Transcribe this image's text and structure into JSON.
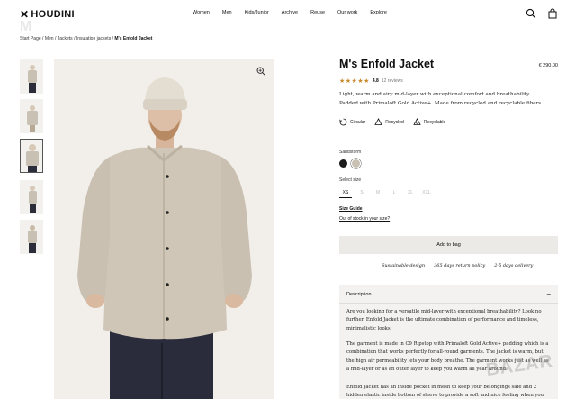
{
  "header": {
    "logo": "HOUDINI",
    "nav": [
      "Women",
      "Men",
      "Kids/Junior",
      "Archive",
      "Reuse",
      "Our work",
      "Explore"
    ],
    "ghost_text": "M"
  },
  "breadcrumb": {
    "items": [
      "Start Page",
      "Men",
      "Jackets",
      "Insulation jackets"
    ],
    "separator": "/",
    "current": "M's Enfold Jacket"
  },
  "product": {
    "title": "M's Enfold Jacket",
    "price": "€ 290.00",
    "stars": "★★★★★",
    "rating": "4.8",
    "reviews": "12 reviews",
    "description": "Light, warm and airy mid-layer with exceptional comfort and breathability. Padded with Primaloft Gold Active+. Made from recycled and recyclable fibers.",
    "badges": [
      "Circular",
      "Recycled",
      "Recyclable"
    ],
    "color_label": "Sandstorm",
    "colors": [
      "#1c1c1c",
      "#c9c2b4"
    ],
    "size_label": "Select size",
    "sizes": [
      "XS",
      "S",
      "M",
      "L",
      "XL",
      "XXL"
    ],
    "selected_size": "XS",
    "size_guide": "Size Guide",
    "out_of_stock": "Out of stock in your size?",
    "add_to_bag": "Add to bag",
    "usps": [
      "Sustainable design",
      "365 days return policy",
      "2-5 days delivery"
    ]
  },
  "description_panel": {
    "heading": "Description",
    "toggle": "−",
    "paragraphs": [
      "Are you looking for a versatile mid-layer with exceptional breathability? Look no further. Enfold Jacket is the ultimate combination of performance and timeless, minimalistic looks.",
      "The garment is made in C9 Ripstop with Primaloft Gold Active+ padding which is a combination that works perfectly for all-round garments. The jacket is warm, but the high air permeability lets your body breathe. The garment works just as well as a mid-layer or as an outer layer to keep you warm all year around.",
      "Enfold Jacket has an inside pocket in mesh to keep your belongings safe and 2 hidden elastic inside bottom of sleeve to provide a soft and nice feeling when you wear it. The"
    ]
  },
  "watermark": "BAZAR"
}
